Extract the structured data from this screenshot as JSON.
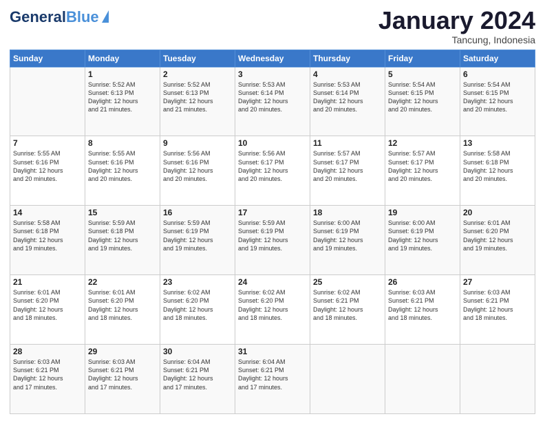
{
  "logo": {
    "name_part1": "General",
    "name_part2": "Blue"
  },
  "header": {
    "month": "January 2024",
    "location": "Tancung, Indonesia"
  },
  "days": [
    "Sunday",
    "Monday",
    "Tuesday",
    "Wednesday",
    "Thursday",
    "Friday",
    "Saturday"
  ],
  "weeks": [
    [
      {
        "day": "",
        "content": ""
      },
      {
        "day": "1",
        "content": "Sunrise: 5:52 AM\nSunset: 6:13 PM\nDaylight: 12 hours\nand 21 minutes."
      },
      {
        "day": "2",
        "content": "Sunrise: 5:52 AM\nSunset: 6:13 PM\nDaylight: 12 hours\nand 21 minutes."
      },
      {
        "day": "3",
        "content": "Sunrise: 5:53 AM\nSunset: 6:14 PM\nDaylight: 12 hours\nand 20 minutes."
      },
      {
        "day": "4",
        "content": "Sunrise: 5:53 AM\nSunset: 6:14 PM\nDaylight: 12 hours\nand 20 minutes."
      },
      {
        "day": "5",
        "content": "Sunrise: 5:54 AM\nSunset: 6:15 PM\nDaylight: 12 hours\nand 20 minutes."
      },
      {
        "day": "6",
        "content": "Sunrise: 5:54 AM\nSunset: 6:15 PM\nDaylight: 12 hours\nand 20 minutes."
      }
    ],
    [
      {
        "day": "7",
        "content": "Sunrise: 5:55 AM\nSunset: 6:16 PM\nDaylight: 12 hours\nand 20 minutes."
      },
      {
        "day": "8",
        "content": "Sunrise: 5:55 AM\nSunset: 6:16 PM\nDaylight: 12 hours\nand 20 minutes."
      },
      {
        "day": "9",
        "content": "Sunrise: 5:56 AM\nSunset: 6:16 PM\nDaylight: 12 hours\nand 20 minutes."
      },
      {
        "day": "10",
        "content": "Sunrise: 5:56 AM\nSunset: 6:17 PM\nDaylight: 12 hours\nand 20 minutes."
      },
      {
        "day": "11",
        "content": "Sunrise: 5:57 AM\nSunset: 6:17 PM\nDaylight: 12 hours\nand 20 minutes."
      },
      {
        "day": "12",
        "content": "Sunrise: 5:57 AM\nSunset: 6:17 PM\nDaylight: 12 hours\nand 20 minutes."
      },
      {
        "day": "13",
        "content": "Sunrise: 5:58 AM\nSunset: 6:18 PM\nDaylight: 12 hours\nand 20 minutes."
      }
    ],
    [
      {
        "day": "14",
        "content": "Sunrise: 5:58 AM\nSunset: 6:18 PM\nDaylight: 12 hours\nand 19 minutes."
      },
      {
        "day": "15",
        "content": "Sunrise: 5:59 AM\nSunset: 6:18 PM\nDaylight: 12 hours\nand 19 minutes."
      },
      {
        "day": "16",
        "content": "Sunrise: 5:59 AM\nSunset: 6:19 PM\nDaylight: 12 hours\nand 19 minutes."
      },
      {
        "day": "17",
        "content": "Sunrise: 5:59 AM\nSunset: 6:19 PM\nDaylight: 12 hours\nand 19 minutes."
      },
      {
        "day": "18",
        "content": "Sunrise: 6:00 AM\nSunset: 6:19 PM\nDaylight: 12 hours\nand 19 minutes."
      },
      {
        "day": "19",
        "content": "Sunrise: 6:00 AM\nSunset: 6:19 PM\nDaylight: 12 hours\nand 19 minutes."
      },
      {
        "day": "20",
        "content": "Sunrise: 6:01 AM\nSunset: 6:20 PM\nDaylight: 12 hours\nand 19 minutes."
      }
    ],
    [
      {
        "day": "21",
        "content": "Sunrise: 6:01 AM\nSunset: 6:20 PM\nDaylight: 12 hours\nand 18 minutes."
      },
      {
        "day": "22",
        "content": "Sunrise: 6:01 AM\nSunset: 6:20 PM\nDaylight: 12 hours\nand 18 minutes."
      },
      {
        "day": "23",
        "content": "Sunrise: 6:02 AM\nSunset: 6:20 PM\nDaylight: 12 hours\nand 18 minutes."
      },
      {
        "day": "24",
        "content": "Sunrise: 6:02 AM\nSunset: 6:20 PM\nDaylight: 12 hours\nand 18 minutes."
      },
      {
        "day": "25",
        "content": "Sunrise: 6:02 AM\nSunset: 6:21 PM\nDaylight: 12 hours\nand 18 minutes."
      },
      {
        "day": "26",
        "content": "Sunrise: 6:03 AM\nSunset: 6:21 PM\nDaylight: 12 hours\nand 18 minutes."
      },
      {
        "day": "27",
        "content": "Sunrise: 6:03 AM\nSunset: 6:21 PM\nDaylight: 12 hours\nand 18 minutes."
      }
    ],
    [
      {
        "day": "28",
        "content": "Sunrise: 6:03 AM\nSunset: 6:21 PM\nDaylight: 12 hours\nand 17 minutes."
      },
      {
        "day": "29",
        "content": "Sunrise: 6:03 AM\nSunset: 6:21 PM\nDaylight: 12 hours\nand 17 minutes."
      },
      {
        "day": "30",
        "content": "Sunrise: 6:04 AM\nSunset: 6:21 PM\nDaylight: 12 hours\nand 17 minutes."
      },
      {
        "day": "31",
        "content": "Sunrise: 6:04 AM\nSunset: 6:21 PM\nDaylight: 12 hours\nand 17 minutes."
      },
      {
        "day": "",
        "content": ""
      },
      {
        "day": "",
        "content": ""
      },
      {
        "day": "",
        "content": ""
      }
    ]
  ]
}
